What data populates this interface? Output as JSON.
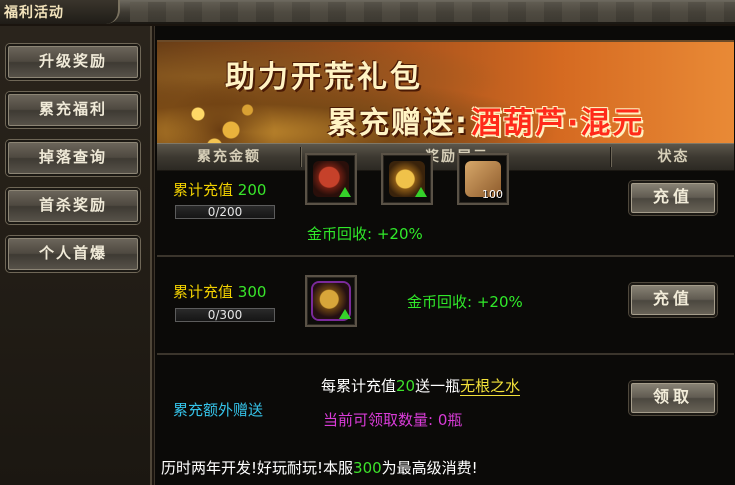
{
  "window": {
    "title": "福利活动"
  },
  "sidebar": {
    "items": [
      {
        "label": "升级奖励"
      },
      {
        "label": "累充福利"
      },
      {
        "label": "掉落查询"
      },
      {
        "label": "首杀奖励"
      },
      {
        "label": "个人首爆"
      }
    ]
  },
  "banner": {
    "line1": "助力开荒礼包",
    "line2_prefix": "累充赠送:",
    "line2_highlight": "酒葫芦·混元"
  },
  "columns": [
    "累充金额",
    "奖励展示",
    "状态"
  ],
  "rows": [
    {
      "label": "累计充值",
      "amount": "200",
      "progress_text": "0/200",
      "progress": 0,
      "items": [
        {
          "icon": "armor-icon",
          "upgrade": true
        },
        {
          "icon": "golden-necklace-icon",
          "upgrade": true
        },
        {
          "icon": "scroll-icon",
          "count": "100"
        }
      ],
      "bonus_label": "金币回收:",
      "bonus_value": "+20%",
      "button": "充值"
    },
    {
      "label": "累计充值",
      "amount": "300",
      "progress_text": "0/300",
      "progress": 0,
      "items": [
        {
          "icon": "gourd-icon",
          "upgrade": true
        }
      ],
      "bonus_label": "金币回收:",
      "bonus_value": "+20%",
      "button": "充值"
    }
  ],
  "extra": {
    "title": "累充额外赠送",
    "rule_prefix": "每累计充值",
    "rule_amount": "20",
    "rule_mid": "送一瓶",
    "rule_item": "无根之水",
    "claimable_label": "当前可领取数量:",
    "claimable_value": "0瓶",
    "button": "领取"
  },
  "footer": {
    "prefix": "历时两年开发!好玩耐玩!本服",
    "amount": "300",
    "suffix": "为最高级消费!"
  },
  "colors": {
    "accent_yellow": "#f1d000",
    "accent_green": "#39e62b",
    "extra_cyan": "#35c2e8",
    "claim_magenta": "#d93cd8"
  }
}
